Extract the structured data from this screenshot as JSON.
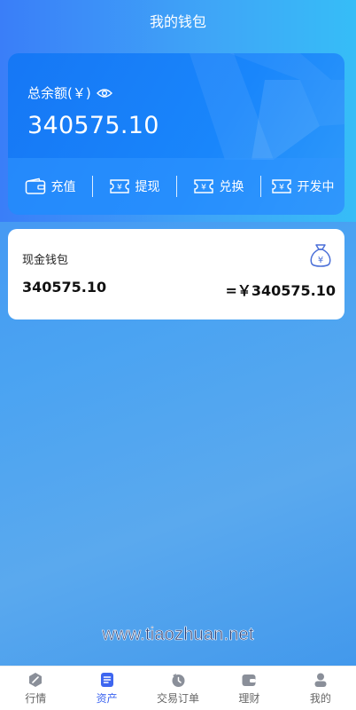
{
  "header": {
    "title": "我的钱包"
  },
  "balance": {
    "label": "总余额(￥)",
    "amount": "340575.10",
    "eye_icon": "eye-icon"
  },
  "actions": [
    {
      "label": "充值",
      "icon": "wallet-icon"
    },
    {
      "label": "提现",
      "icon": "ticket-yen-icon"
    },
    {
      "label": "兑换",
      "icon": "ticket-yen-icon"
    },
    {
      "label": "开发中",
      "icon": "ticket-yen-icon"
    }
  ],
  "wallet": {
    "title": "现金钱包",
    "value": "340575.10",
    "equivalent": "=￥340575.10",
    "icon": "money-bag-icon"
  },
  "watermark": "www.tiaozhuan.net",
  "tabs": [
    {
      "label": "行情",
      "icon": "market-icon",
      "active": false
    },
    {
      "label": "资产",
      "icon": "assets-icon",
      "active": true
    },
    {
      "label": "交易订单",
      "icon": "orders-icon",
      "active": false
    },
    {
      "label": "理财",
      "icon": "finance-icon",
      "active": false
    },
    {
      "label": "我的",
      "icon": "profile-icon",
      "active": false
    }
  ],
  "colors": {
    "accent": "#3e66f0",
    "card_blue": "#1986fb",
    "background": "#4aa3f2"
  }
}
